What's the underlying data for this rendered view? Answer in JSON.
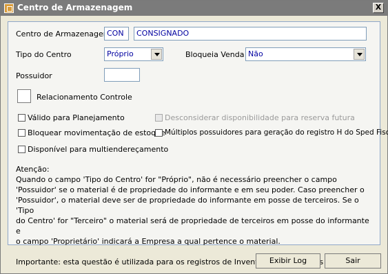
{
  "window": {
    "title": "Centro de Armazenagem",
    "close_label": "X"
  },
  "form": {
    "centro_label": "Centro de Armazenagem",
    "centro_code": "CON",
    "centro_name": "CONSIGNADO",
    "tipo_label": "Tipo do Centro",
    "tipo_value": "Próprio",
    "bloqueia_label": "Bloqueia Venda",
    "bloqueia_value": "Não",
    "possuidor_label": "Possuidor",
    "possuidor_value": "",
    "relacionamento_label": "Relacionamento Controle"
  },
  "checkboxes": {
    "valido": "Válido para Planejamento",
    "desconsiderar": "Desconsiderar disponibilidade para reserva futura",
    "bloquear": "Bloquear movimentação de estoque",
    "multiplos": "Múltiplos possuidores para geração do registro H do Sped Fiscal",
    "disponivel": "Disponível para multiendereçamento"
  },
  "info": {
    "heading": "Atenção:",
    "lines": [
      "Quando o campo 'Tipo do Centro' for \"Próprio\", não é necessário preencher o campo",
      "'Possuidor' se o material é de propriedade do informante e em seu poder. Caso preencher o",
      "'Possuidor', o material deve ser de propriedade do informante em posse de terceiros. Se o 'Tipo",
      "do Centro' for \"Terceiro\" o material será de propriedade de terceiros em posse do informante e",
      "o campo 'Proprietário' indicará a Empresa a qual pertence o material."
    ],
    "important": "Importante: esta questão é utilizada para os registros de Inventário dos arquivos legais."
  },
  "buttons": {
    "exibir_log": "Exibir Log",
    "sair": "Sair"
  }
}
